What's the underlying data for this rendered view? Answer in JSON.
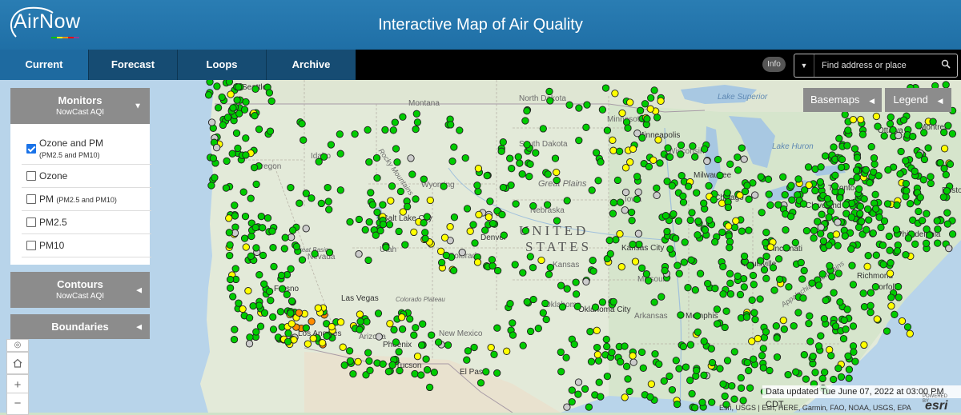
{
  "header": {
    "logo_text": "AirNow",
    "title": "Interactive Map of Air Quality"
  },
  "nav": {
    "tabs": [
      {
        "label": "Current",
        "active": true
      },
      {
        "label": "Forecast",
        "active": false
      },
      {
        "label": "Loops",
        "active": false
      },
      {
        "label": "Archive",
        "active": false
      }
    ],
    "info_label": "Info",
    "search_placeholder": "Find address or place"
  },
  "panels": {
    "monitors": {
      "title": "Monitors",
      "subtitle": "NowCast AQI"
    },
    "options": [
      {
        "label": "Ozone and PM",
        "sub": "(PM2.5 and PM10)",
        "checked": true
      },
      {
        "label": "Ozone",
        "sub": "",
        "checked": false
      },
      {
        "label": "PM",
        "sub": "(PM2.5 and PM10)",
        "checked": false
      },
      {
        "label": "PM2.5",
        "sub": "",
        "checked": false
      },
      {
        "label": "PM10",
        "sub": "",
        "checked": false
      }
    ],
    "contours": {
      "title": "Contours",
      "subtitle": "NowCast AQI"
    },
    "boundaries": {
      "title": "Boundaries"
    }
  },
  "right_buttons": {
    "basemaps": "Basemaps",
    "legend": "Legend"
  },
  "zoom": {
    "in": "+",
    "out": "−"
  },
  "status": {
    "updated": "Data updated Tue June 07, 2022 at 03:00 PM CDT",
    "attribution": "Esri, USGS | Esri, HERE, Garmin, FAO, NOAA, USGS, EPA",
    "esri_powered": "POWERED BY",
    "esri_word": "esri"
  },
  "map_labels": [
    {
      "text": "UNITED",
      "kind": "big"
    },
    {
      "text": "STATES",
      "kind": "big"
    },
    {
      "text": "Montana",
      "kind": "state"
    },
    {
      "text": "North Dakota",
      "kind": "state"
    },
    {
      "text": "South Dakota",
      "kind": "state"
    },
    {
      "text": "Minnesota",
      "kind": "state"
    },
    {
      "text": "Idaho",
      "kind": "state"
    },
    {
      "text": "Oregon",
      "kind": "state"
    },
    {
      "text": "Wyoming",
      "kind": "state"
    },
    {
      "text": "Nebraska",
      "kind": "state"
    },
    {
      "text": "Iowa",
      "kind": "state"
    },
    {
      "text": "Kansas",
      "kind": "state"
    },
    {
      "text": "Missouri",
      "kind": "state"
    },
    {
      "text": "Oklahoma",
      "kind": "state"
    },
    {
      "text": "Arkansas",
      "kind": "state"
    },
    {
      "text": "New Mexico",
      "kind": "state"
    },
    {
      "text": "Arizona",
      "kind": "state"
    },
    {
      "text": "Utah",
      "kind": "state"
    },
    {
      "text": "Colorado",
      "kind": "state"
    },
    {
      "text": "Nevada",
      "kind": "state"
    },
    {
      "text": "Wisconsin",
      "kind": "state"
    },
    {
      "text": "Great Plains",
      "kind": "ital"
    },
    {
      "text": "Great Basin",
      "kind": "ital"
    },
    {
      "text": "Colorado Plateau",
      "kind": "ital"
    },
    {
      "text": "Lake Superior",
      "kind": "water"
    },
    {
      "text": "Lake Huron",
      "kind": "water"
    },
    {
      "text": "Salt Lake City",
      "kind": "city"
    },
    {
      "text": "Denver",
      "kind": "city"
    },
    {
      "text": "Las Vegas",
      "kind": "city"
    },
    {
      "text": "Phoenix",
      "kind": "city"
    },
    {
      "text": "Tucson",
      "kind": "city"
    },
    {
      "text": "El Paso",
      "kind": "city"
    },
    {
      "text": "Kansas City",
      "kind": "city"
    },
    {
      "text": "Oklahoma City",
      "kind": "city"
    },
    {
      "text": "Memphis",
      "kind": "city"
    },
    {
      "text": "Louisville",
      "kind": "city"
    },
    {
      "text": "Cincinnati",
      "kind": "city"
    },
    {
      "text": "Cleveland",
      "kind": "city"
    },
    {
      "text": "Toronto",
      "kind": "city"
    },
    {
      "text": "Ottawa",
      "kind": "city"
    },
    {
      "text": "Montreal",
      "kind": "city"
    },
    {
      "text": "Boston",
      "kind": "city"
    },
    {
      "text": "Philadelphia",
      "kind": "city"
    },
    {
      "text": "Richmond",
      "kind": "city"
    },
    {
      "text": "Norfolk",
      "kind": "city"
    },
    {
      "text": "Milwaukee",
      "kind": "city"
    },
    {
      "text": "Minneapolis",
      "kind": "city"
    },
    {
      "text": "Chicago",
      "kind": "city"
    },
    {
      "text": "Seattle",
      "kind": "city"
    },
    {
      "text": "Fresno",
      "kind": "city"
    },
    {
      "text": "Los Angeles",
      "kind": "city"
    },
    {
      "text": "Appalachian Mountains",
      "kind": "ital"
    },
    {
      "text": "Rocky Mountains",
      "kind": "ital"
    }
  ],
  "aqi_colors": {
    "good": "#00cc00",
    "moderate": "#ffff00",
    "usg": "#ff8c00",
    "no_data": "#cccccc"
  }
}
